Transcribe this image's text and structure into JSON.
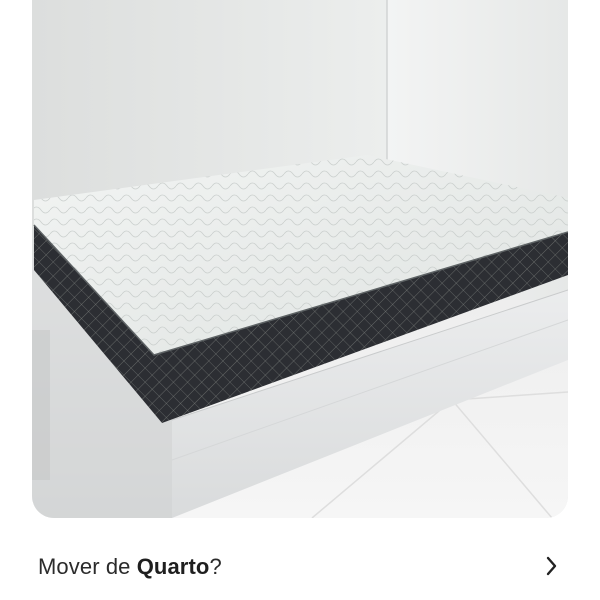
{
  "photo": {
    "alt_icon": "bed-mattress-photo"
  },
  "caption": {
    "prefix": "Mover de ",
    "bold": "Quarto",
    "suffix": "?"
  },
  "action": {
    "icon": "chevron-right-icon"
  }
}
